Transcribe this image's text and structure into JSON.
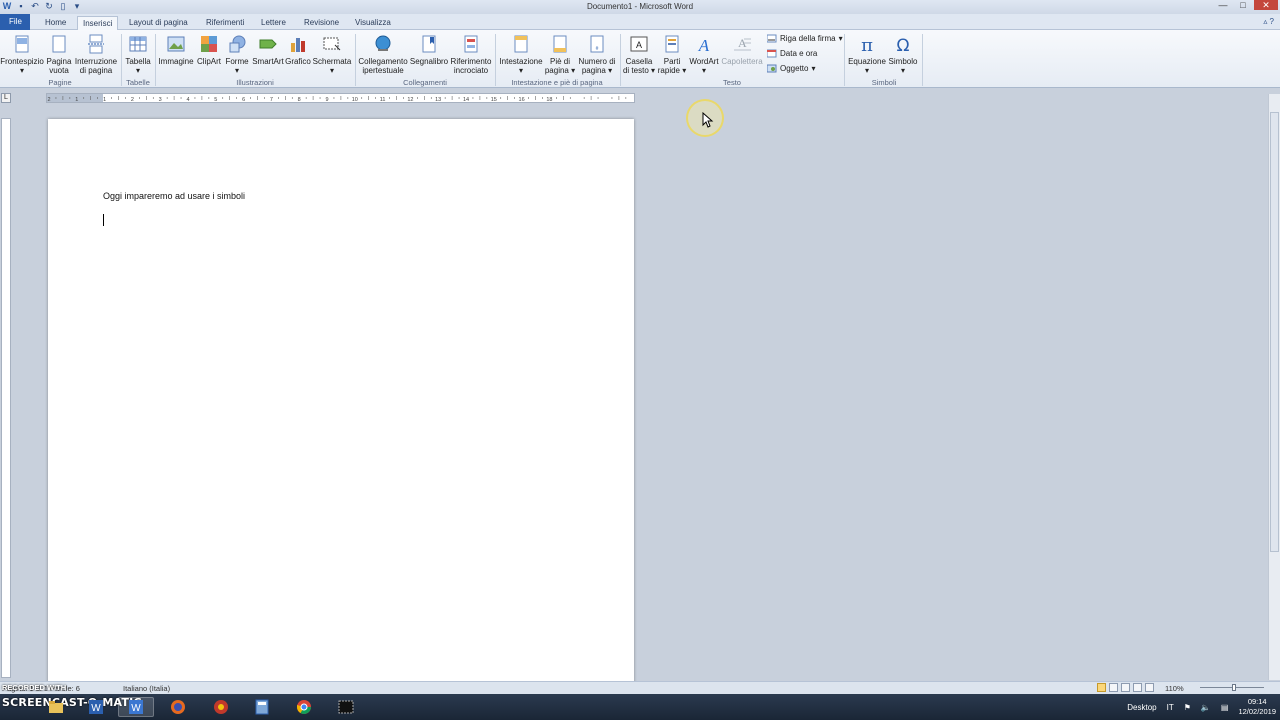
{
  "window": {
    "title": "Documento1 - Microsoft Word",
    "controls": {
      "minimize": "—",
      "maximize": "□",
      "close": "✕"
    }
  },
  "quick_access": {
    "icons": [
      "word-icon",
      "save-icon",
      "undo-icon",
      "redo-icon",
      "new-doc-icon",
      "customize-icon"
    ]
  },
  "tabs": [
    {
      "label": "File",
      "active": false
    },
    {
      "label": "Home",
      "active": false
    },
    {
      "label": "Inserisci",
      "active": true
    },
    {
      "label": "Layout di pagina",
      "active": false
    },
    {
      "label": "Riferimenti",
      "active": false
    },
    {
      "label": "Lettere",
      "active": false
    },
    {
      "label": "Revisione",
      "active": false
    },
    {
      "label": "Visualizza",
      "active": false
    }
  ],
  "ribbon": {
    "groups": {
      "pagine": "Pagine",
      "tabelle": "Tabelle",
      "illustrazioni": "Illustrazioni",
      "collegamenti": "Collegamenti",
      "intestazione": "Intestazione e piè di pagina",
      "testo": "Testo",
      "simboli": "Simboli"
    },
    "buttons": {
      "frontespizio": "Frontespizio",
      "pagina_vuota_1": "Pagina",
      "pagina_vuota_2": "vuota",
      "interruzione_1": "Interruzione",
      "interruzione_2": "di pagina",
      "tabella": "Tabella",
      "immagine": "Immagine",
      "clipart": "ClipArt",
      "forme": "Forme",
      "smartart": "SmartArt",
      "grafico": "Grafico",
      "schermata": "Schermata",
      "collegamento_1": "Collegamento",
      "collegamento_2": "ipertestuale",
      "segnalibro": "Segnalibro",
      "riferimento_1": "Riferimento",
      "riferimento_2": "incrociato",
      "intestazione": "Intestazione",
      "pie_1": "Piè di",
      "pie_2": "pagina",
      "numero_1": "Numero di",
      "numero_2": "pagina",
      "casella_1": "Casella",
      "casella_2": "di testo",
      "parti_1": "Parti",
      "parti_2": "rapide",
      "wordart": "WordArt",
      "capolettera": "Capolettera",
      "riga_firma": "Riga della firma",
      "data_ora": "Data e ora",
      "oggetto": "Oggetto",
      "equazione": "Equazione",
      "simbolo": "Simbolo"
    }
  },
  "ruler": {
    "numbers": [
      "2",
      "1",
      "1",
      "2",
      "3",
      "4",
      "5",
      "6",
      "7",
      "8",
      "9",
      "10",
      "11",
      "12",
      "13",
      "14",
      "15",
      "16",
      "18"
    ]
  },
  "document": {
    "line1": "Oggi impareremo ad usare i simboli"
  },
  "status": {
    "page_info": "Pagina: 1 di 1   Parole: 6",
    "language": "Italiano (Italia)",
    "zoom": "110%"
  },
  "watermark": {
    "top": "RECORDED WITH",
    "bottom": "SCREENCAST-O-MATIC"
  },
  "taskbar": {
    "apps": [
      "explorer-icon",
      "word-icon",
      "firefox-icon",
      "app-icon",
      "calculator-icon",
      "chrome-icon",
      "terminal-icon"
    ],
    "desktop": "Desktop",
    "lang": "IT",
    "time": "09:14",
    "date": "12/02/2019"
  }
}
